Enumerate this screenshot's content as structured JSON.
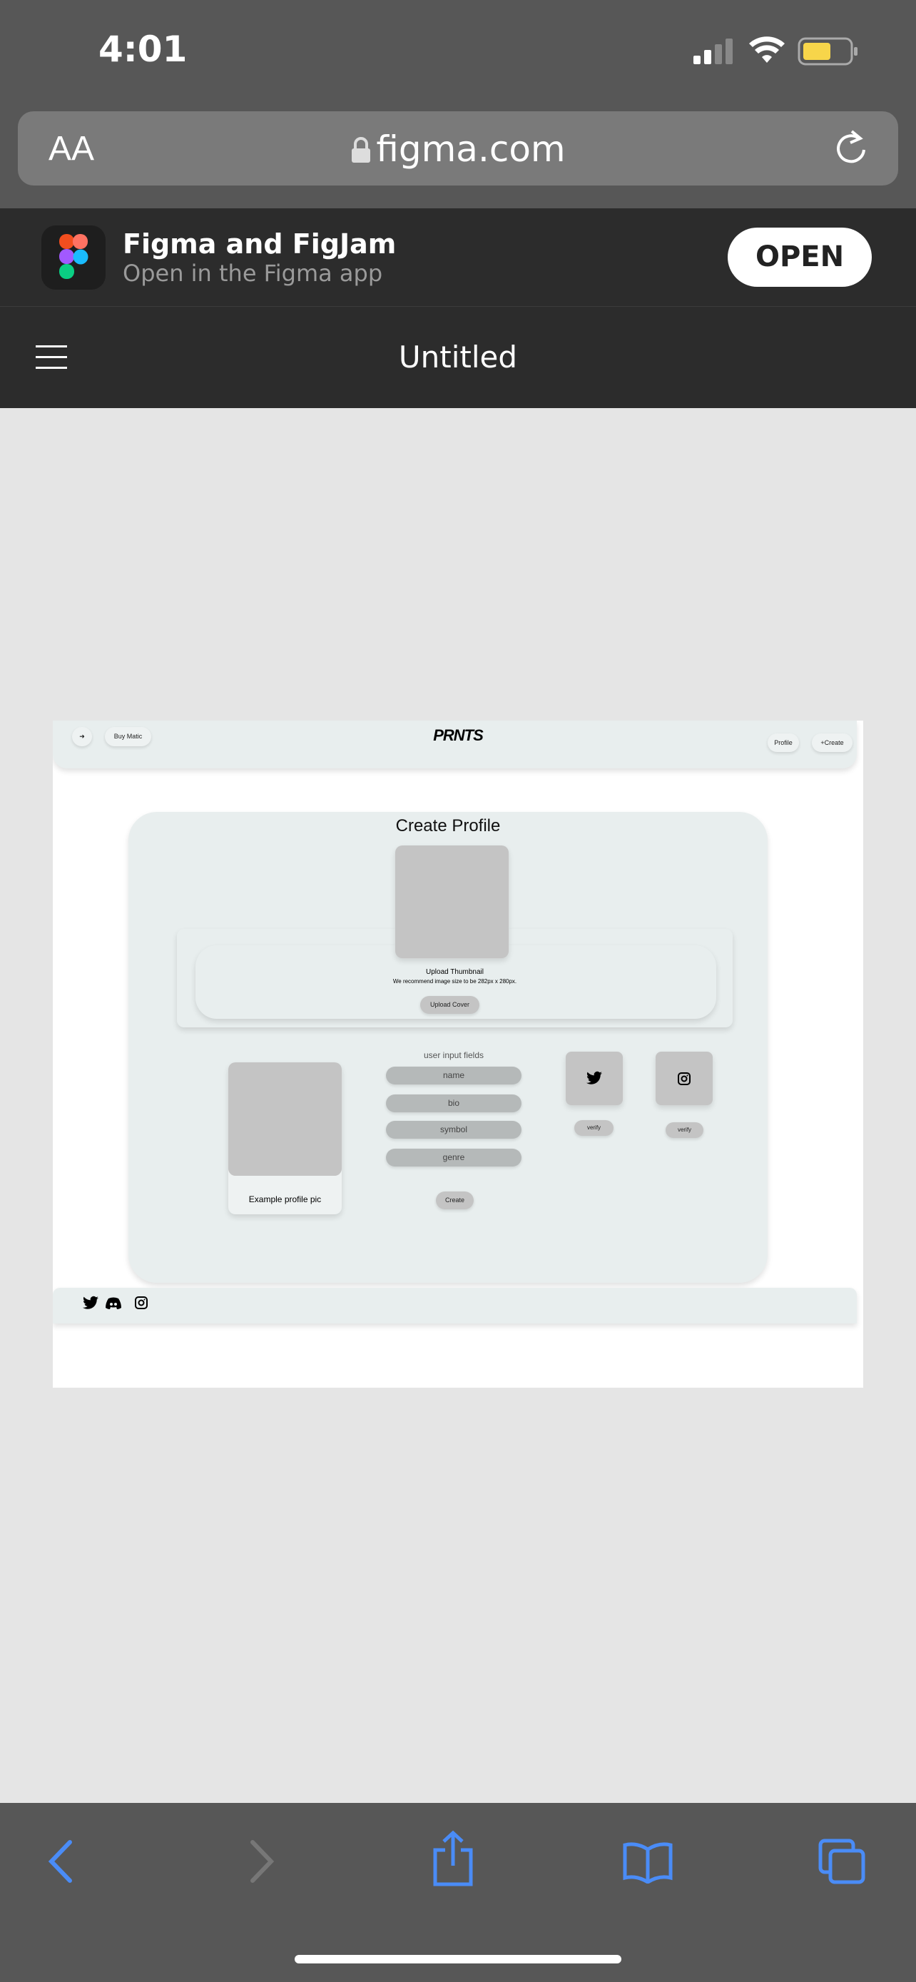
{
  "status_bar": {
    "time": "4:01",
    "battery_color": "#f7d54a"
  },
  "url_bar": {
    "text_size_label": "AA",
    "domain": "figma.com",
    "icons": [
      "lock-icon",
      "reload-icon"
    ]
  },
  "app_banner": {
    "title": "Figma and FigJam",
    "subtitle": "Open in the Figma app",
    "open_label": "OPEN"
  },
  "header": {
    "title": "Untitled",
    "menu_icon": "hamburger-icon"
  },
  "prototype": {
    "nav": {
      "buy_label": "Buy Matic",
      "logo": "PRNTS",
      "profile_label": "Profile",
      "create_label": "+Create"
    },
    "card": {
      "title": "Create Profile",
      "upload_thumbnail": "Upload Thumbnail",
      "recommend": "We recommend image size to be 282px x 280px.",
      "upload_cover": "Upload Cover",
      "profile_pic_label": "Example profile pic",
      "fields_label": "user input fields",
      "fields": [
        "name",
        "bio",
        "symbol",
        "genre"
      ],
      "create_label": "Create",
      "verify_label": "verify"
    },
    "footer_icons": [
      "twitter-icon",
      "discord-icon",
      "instagram-icon"
    ]
  },
  "colors": {
    "accent": "#4a8cf7",
    "panel": "#e8eeee",
    "placeholder": "#c4c4c4"
  }
}
